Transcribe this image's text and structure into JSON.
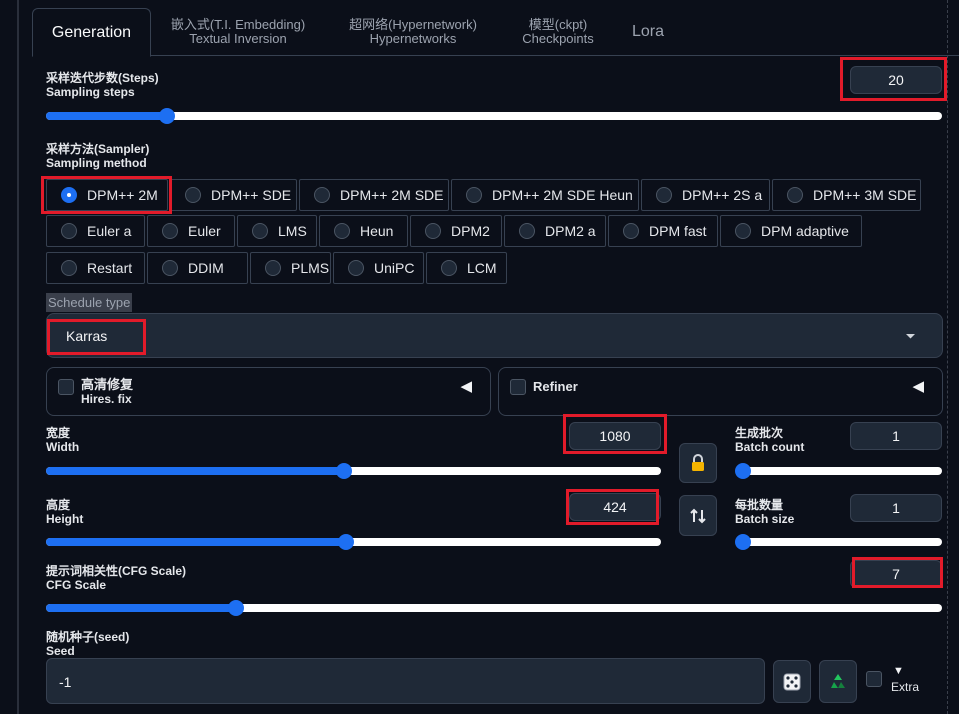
{
  "tabs": [
    {
      "label": "Generation",
      "sub": ""
    },
    {
      "label": "嵌入式(T.I. Embedding)",
      "sub": "Textual Inversion"
    },
    {
      "label": "超网络(Hypernetwork)",
      "sub": "Hypernetworks"
    },
    {
      "label": "模型(ckpt)",
      "sub": "Checkpoints"
    },
    {
      "label": "Lora",
      "sub": ""
    }
  ],
  "steps": {
    "label_cn": "采样迭代步数(Steps)",
    "label_en": "Sampling steps",
    "value": "20",
    "fraction": 0.135
  },
  "sampler": {
    "label_cn": "采样方法(Sampler)",
    "label_en": "Sampling method",
    "selected": "DPM++ 2M",
    "options": [
      "DPM++ 2M",
      "DPM++ SDE",
      "DPM++ 2M SDE",
      "DPM++ 2M SDE Heun",
      "DPM++ 2S a",
      "DPM++ 3M SDE",
      "Euler a",
      "Euler",
      "LMS",
      "Heun",
      "DPM2",
      "DPM2 a",
      "DPM fast",
      "DPM adaptive",
      "Restart",
      "DDIM",
      "PLMS",
      "UniPC",
      "LCM"
    ]
  },
  "schedule": {
    "label": "Schedule type",
    "value": "Karras"
  },
  "hires": {
    "label_cn": "高清修复",
    "label_en": "Hires. fix",
    "arrow": "◀"
  },
  "refiner": {
    "label": "Refiner",
    "arrow": "◀"
  },
  "width": {
    "label_cn": "宽度",
    "label_en": "Width",
    "value": "1080",
    "fraction": 0.485
  },
  "height": {
    "label_cn": "高度",
    "label_en": "Height",
    "value": "424",
    "fraction": 0.488
  },
  "batch_count": {
    "label_cn": "生成批次",
    "label_en": "Batch count",
    "value": "1",
    "fraction": 0.0
  },
  "batch_size": {
    "label_cn": "每批数量",
    "label_en": "Batch size",
    "value": "1",
    "fraction": 0.0
  },
  "cfg": {
    "label_cn": "提示词相关性(CFG Scale)",
    "label_en": "CFG Scale",
    "value": "7",
    "fraction": 0.212
  },
  "seed": {
    "label_cn": "随机种子(seed)",
    "label_en": "Seed",
    "value": "-1"
  },
  "extra": {
    "label": "Extra",
    "arrow": "▼"
  },
  "icons": {
    "lock": "lock-icon",
    "swap": "swap-icon",
    "dice": "dice-icon",
    "recycle": "recycle-icon"
  },
  "colors": {
    "accent": "#1d6ff2",
    "highlight": "#e21b2a",
    "background": "#0b0f19"
  }
}
